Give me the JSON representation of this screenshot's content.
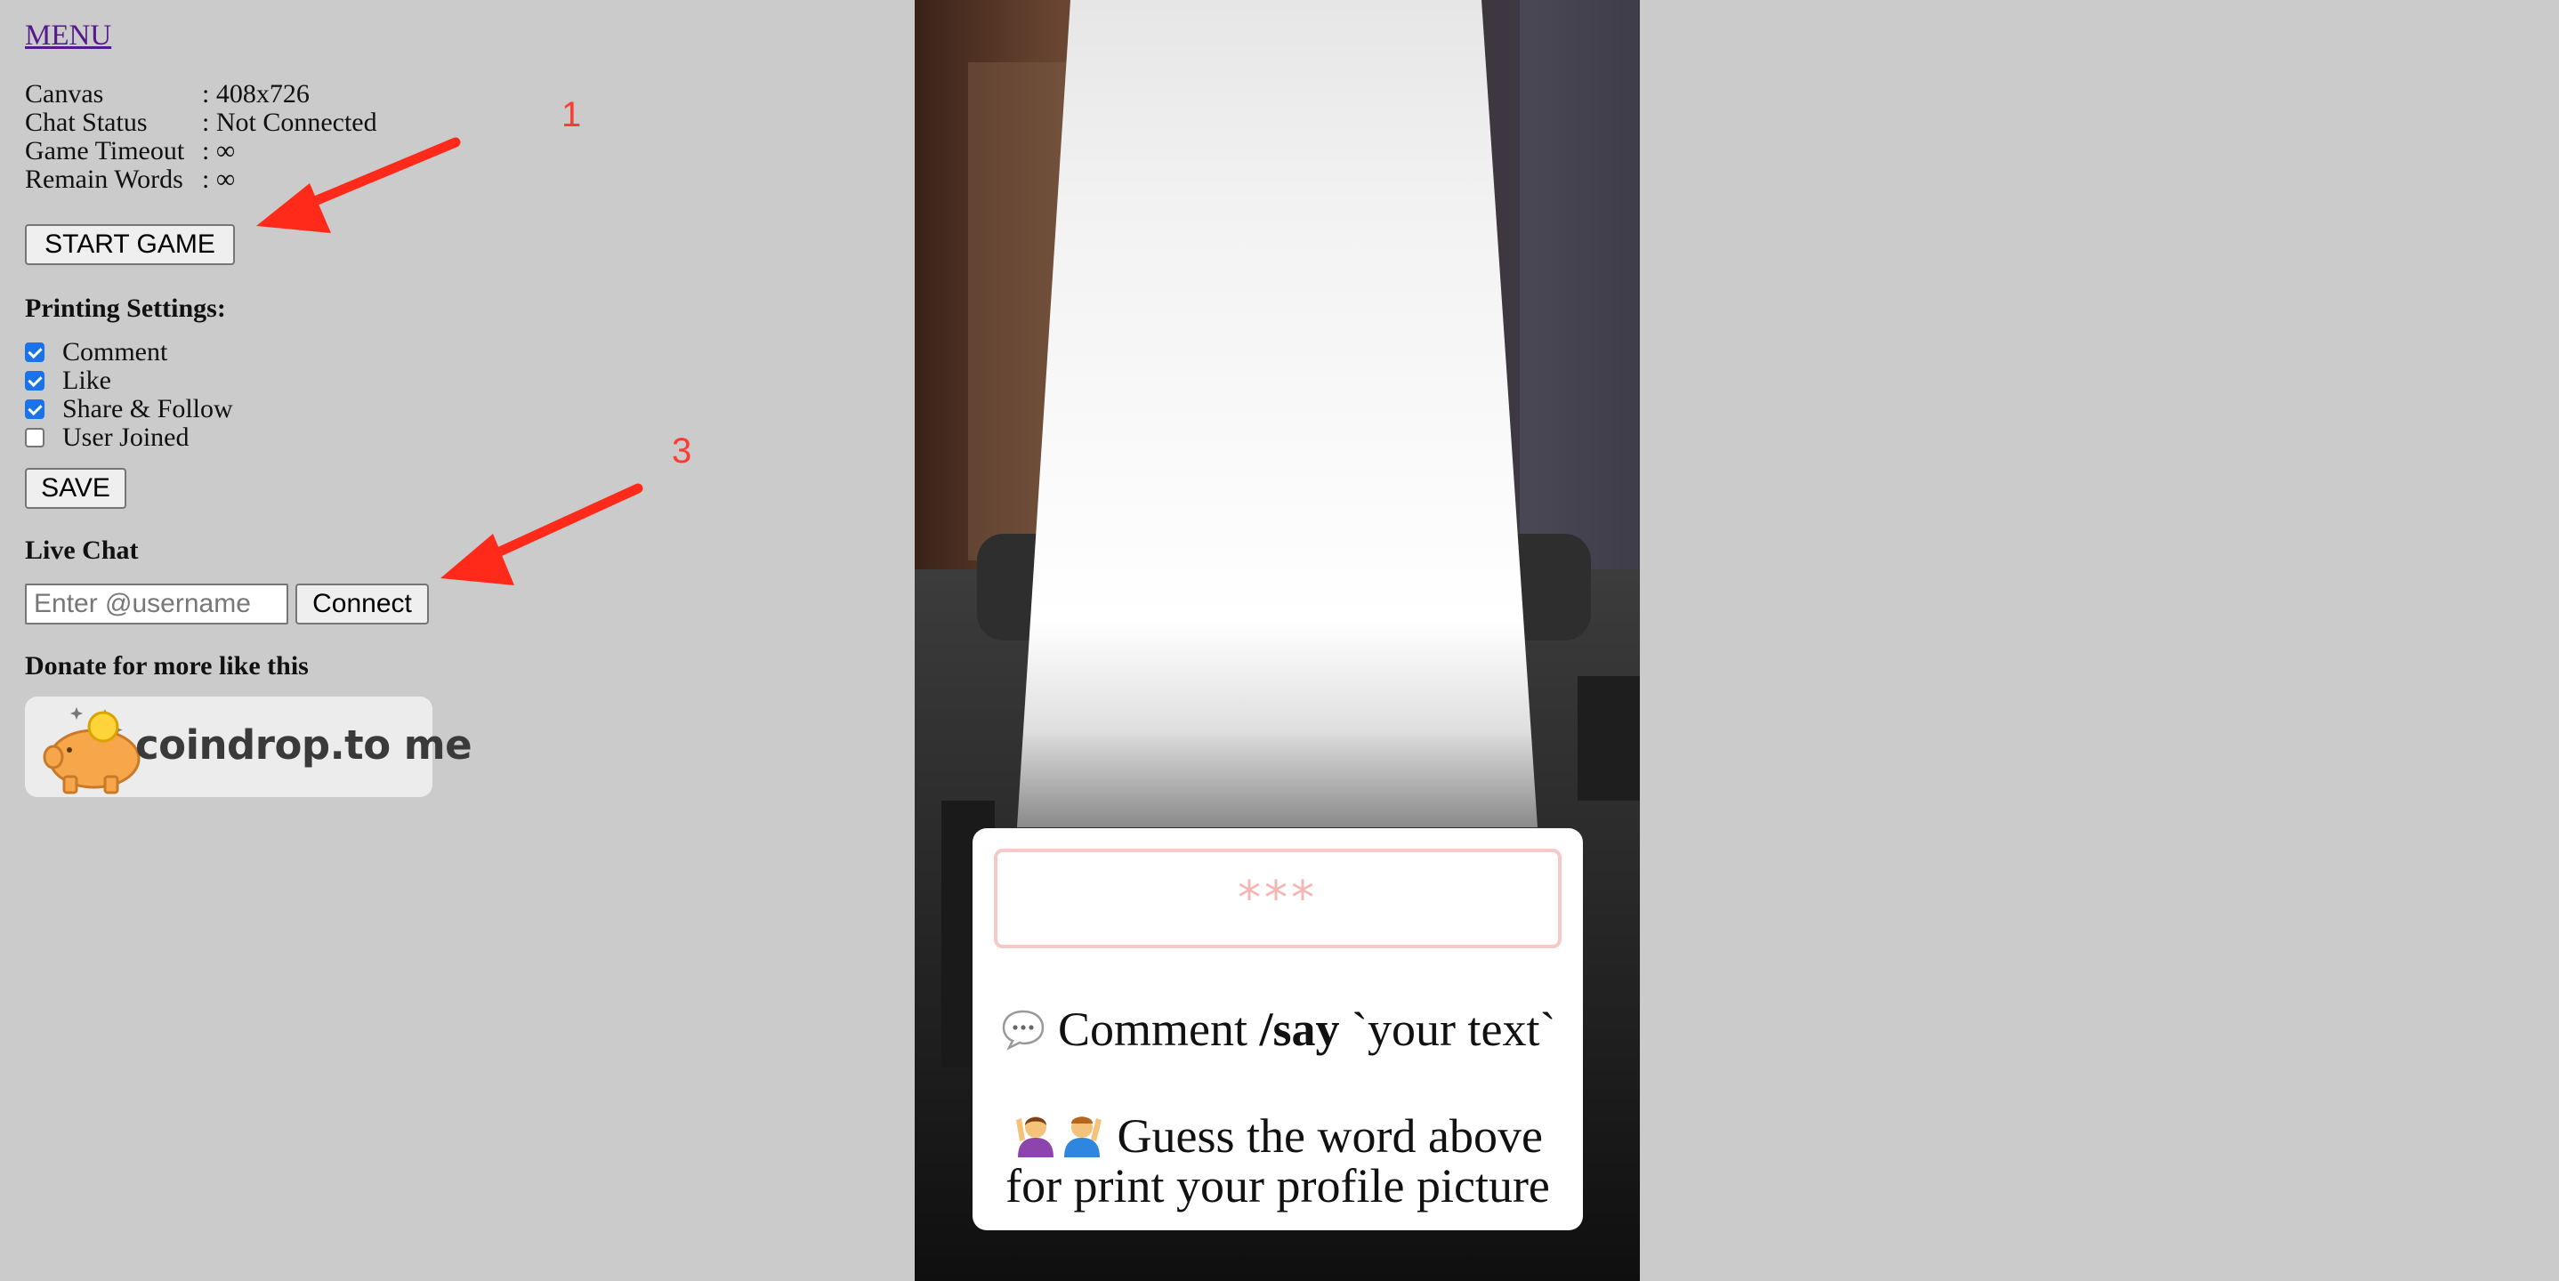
{
  "menu": {
    "label": "MENU"
  },
  "info": [
    {
      "key": "Canvas",
      "value": ": 408x726"
    },
    {
      "key": "Chat Status",
      "value": ": Not Connected"
    },
    {
      "key": "Game Timeout",
      "value": ": ∞"
    },
    {
      "key": "Remain Words",
      "value": ": ∞"
    }
  ],
  "buttons": {
    "start_game": "START GAME",
    "save": "SAVE",
    "connect": "Connect"
  },
  "printing": {
    "title": "Printing Settings:",
    "options": [
      {
        "label": "Comment",
        "checked": true
      },
      {
        "label": "Like",
        "checked": true
      },
      {
        "label": "Share & Follow",
        "checked": true
      },
      {
        "label": "User Joined",
        "checked": false
      }
    ]
  },
  "live_chat": {
    "title": "Live Chat",
    "username_value": "",
    "username_placeholder": "Enter @username"
  },
  "donate": {
    "title": "Donate for more like this",
    "badge_text": "coindrop.to me"
  },
  "annotations": {
    "first": "1",
    "second": "3",
    "color": "#ff3b2f"
  },
  "game": {
    "hidden_word": "***",
    "comment_prefix": "Comment ",
    "command": "/say",
    "command_arg": " `your text`",
    "guess_line1": " Guess the word above",
    "guess_line2": "for print your profile picture",
    "icons": [
      "speech-bubble-icon",
      "person-raising-hand-icon",
      "man-raising-hand-icon"
    ]
  },
  "colors": {
    "page_bg": "#cbcbcb",
    "link": "#551a8b",
    "word_border": "#f6c8c6",
    "word_text": "#f4b6b3"
  }
}
